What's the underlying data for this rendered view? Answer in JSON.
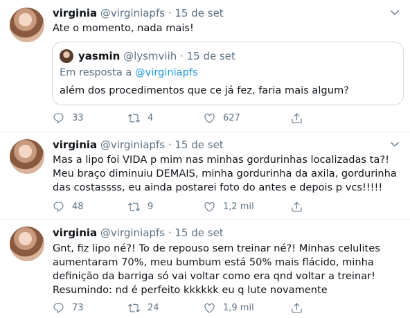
{
  "tweets": [
    {
      "name": "virginia",
      "handle": "@virginiapfs",
      "dot": "·",
      "date": "15 de set",
      "text": "Ate o momento, nada mais!",
      "quote": {
        "name": "yasmin",
        "handle": "@lysmviih",
        "dot": "·",
        "date": "15 de set",
        "reply_prefix": "Em resposta a ",
        "reply_mention": "@virginiapfs",
        "text": "além dos procedimentos que ce já fez, faria mais algum?"
      },
      "replies": "33",
      "retweets": "4",
      "likes": "627"
    },
    {
      "name": "virginia",
      "handle": "@virginiapfs",
      "dot": "·",
      "date": "15 de set",
      "text": "Mas a lipo foi VIDA p mim nas minhas gordurinhas localizadas ta?! Meu braço diminuiu DEMAIS, minha gordurinha da axila, gordurinha das costassss, eu ainda postarei foto do antes e depois p vcs!!!!!",
      "replies": "48",
      "retweets": "9",
      "likes": "1,2 mil"
    },
    {
      "name": "virginia",
      "handle": "@virginiapfs",
      "dot": "·",
      "date": "15 de set",
      "text": "Gnt, fiz lipo né?! To de repouso sem treinar né?! Minhas celulites aumentaram 70%, meu bumbum está 50% mais flácido, minha definição da barriga só vai voltar como era qnd voltar a treinar! Resumindo: nd é perfeito kkkkkk eu q lute novamente",
      "replies": "73",
      "retweets": "24",
      "likes": "1,9 mil"
    }
  ],
  "icons": {
    "reply": "reply-icon",
    "retweet": "retweet-icon",
    "like": "heart-icon",
    "share": "share-icon",
    "caret": "chevron-down-icon"
  },
  "colors": {
    "text": "#0f1419",
    "secondary": "#5b7083",
    "link": "#1b95e0",
    "border": "#e6ecf0"
  }
}
